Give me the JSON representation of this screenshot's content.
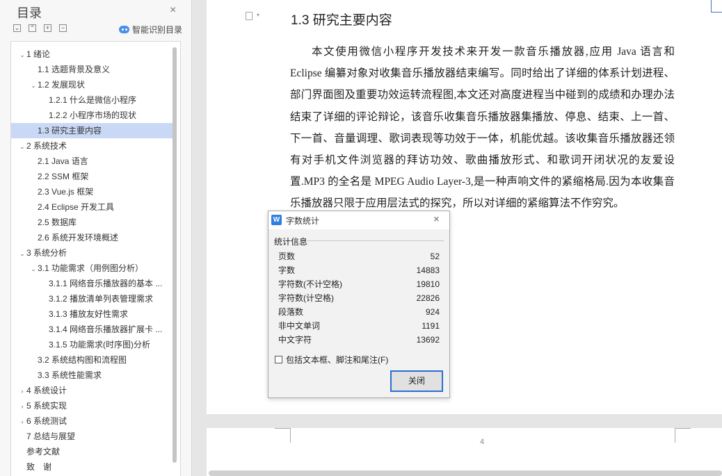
{
  "sidebar": {
    "title": "目录",
    "close_label": "×",
    "tools": [
      "⌄",
      "⌃",
      "+",
      "−"
    ],
    "smart_label": "智能识别目录",
    "toc": [
      {
        "label": "1 绪论",
        "level": 0,
        "arrow": "⌄"
      },
      {
        "label": "1.1 选题背景及意义",
        "level": 1,
        "arrow": ""
      },
      {
        "label": "1.2 发展现状",
        "level": 1,
        "arrow": "⌄"
      },
      {
        "label": "1.2.1 什么是微信小程序",
        "level": 2,
        "arrow": ""
      },
      {
        "label": "1.2.2 小程序市场的现状",
        "level": 2,
        "arrow": ""
      },
      {
        "label": "1.3 研究主要内容",
        "level": 1,
        "arrow": "",
        "selected": true
      },
      {
        "label": "2 系统技术",
        "level": 0,
        "arrow": "⌄"
      },
      {
        "label": "2.1 Java 语言",
        "level": 1,
        "arrow": ""
      },
      {
        "label": "2.2 SSM 框架",
        "level": 1,
        "arrow": ""
      },
      {
        "label": "2.3 Vue.js 框架",
        "level": 1,
        "arrow": ""
      },
      {
        "label": "2.4 Eclipse 开发工具",
        "level": 1,
        "arrow": ""
      },
      {
        "label": "2.5 数据库",
        "level": 1,
        "arrow": ""
      },
      {
        "label": "2.6 系统开发环境概述",
        "level": 1,
        "arrow": ""
      },
      {
        "label": "3 系统分析",
        "level": 0,
        "arrow": "⌄"
      },
      {
        "label": "3.1  功能需求（用例图分析）",
        "level": 1,
        "arrow": "⌄"
      },
      {
        "label": "3.1.1  网络音乐播放器的基本 ...",
        "level": 2,
        "arrow": ""
      },
      {
        "label": "3.1.2  播放清单列表管理需求",
        "level": 2,
        "arrow": ""
      },
      {
        "label": "3.1.3  播放友好性需求",
        "level": 2,
        "arrow": ""
      },
      {
        "label": "3.1.4  网络音乐播放器扩展卡 ...",
        "level": 2,
        "arrow": ""
      },
      {
        "label": "3.1.5  功能需求(时序图)分析",
        "level": 2,
        "arrow": ""
      },
      {
        "label": "3.2  系统结构图和流程图",
        "level": 1,
        "arrow": ""
      },
      {
        "label": "3.3  系统性能需求",
        "level": 1,
        "arrow": ""
      },
      {
        "label": "4 系统设计",
        "level": 0,
        "arrow": "›"
      },
      {
        "label": "5 系统实现",
        "level": 0,
        "arrow": "›"
      },
      {
        "label": "6 系统测试",
        "level": 0,
        "arrow": "›"
      },
      {
        "label": "7 总结与展望",
        "level": 0,
        "arrow": ""
      },
      {
        "label": "参考文献",
        "level": 0,
        "arrow": ""
      },
      {
        "label": "致　谢",
        "level": 0,
        "arrow": ""
      }
    ]
  },
  "document": {
    "heading": "1.3 研究主要内容",
    "paragraph": "本文使用微信小程序开发技术来开发一款音乐播放器,应用 Java 语言和 Eclipse 编纂对象对收集音乐播放器结束编写。同时给出了详细的体系计划进程、部门界面图及重要功效运转流程图,本文还对高度进程当中碰到的成绩和办理办法结束了详细的评论辩论，该音乐收集音乐播放器集播放、停息、结束、上一首、下一首、音量调理、歌词表现等功效于一体，机能优越。该收集音乐播放器还领有对手机文件浏览器的拜访功效、歌曲播放形式、和歌词开闭状况的友爱设置.MP3 的全名是 MPEG Audio Layer-3,是一种声响文件的紧缩格局.因为本收集音乐播放器只限于应用层法式的探究，所以对详细的紧缩算法不作穷究。",
    "page_number": "4"
  },
  "dialog": {
    "icon_text": "W",
    "title": "字数统计",
    "close_label": "×",
    "group_label": "统计信息",
    "stats": [
      {
        "label": "页数",
        "value": "52"
      },
      {
        "label": "字数",
        "value": "14883"
      },
      {
        "label": "字符数(不计空格)",
        "value": "19810"
      },
      {
        "label": "字符数(计空格)",
        "value": "22826"
      },
      {
        "label": "段落数",
        "value": "924"
      },
      {
        "label": "非中文单词",
        "value": "1191"
      },
      {
        "label": "中文字符",
        "value": "13692"
      }
    ],
    "checkbox_label": "包括文本框、脚注和尾注(F)",
    "button_label": "关闭"
  }
}
